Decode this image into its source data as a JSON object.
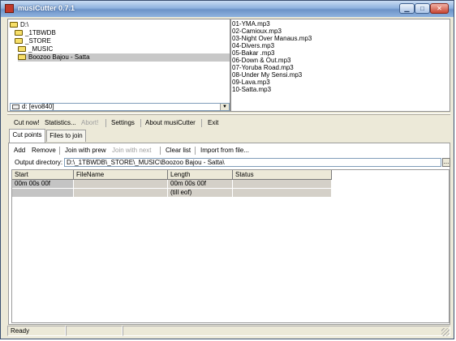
{
  "window": {
    "title": "musiCutter 0.7.1"
  },
  "tree": {
    "items": [
      {
        "label": "D:\\",
        "level": 0,
        "selected": false
      },
      {
        "label": "_1TBWDB",
        "level": 1,
        "selected": false
      },
      {
        "label": "_STORE",
        "level": 1,
        "selected": false
      },
      {
        "label": "_MUSIC",
        "level": 2,
        "selected": false
      },
      {
        "label": "Boozoo Bajou - Satta",
        "level": 2,
        "selected": true
      }
    ],
    "drive": "d: [evo840]"
  },
  "files": [
    "01-YMA.mp3",
    "02-Camioux.mp3",
    "03-Night Over Manaus.mp3",
    "04-Divers.mp3",
    "05-Bakar .mp3",
    "06-Down & Out.mp3",
    "07-Yoruba Road.mp3",
    "08-Under My Sensi.mp3",
    "09-Lava.mp3",
    "10-Satta.mp3"
  ],
  "toolbar": {
    "cut_now": "Cut now!",
    "statistics": "Statistics...",
    "abort": "Abort!",
    "settings": "Settings",
    "about": "About musiCutter",
    "exit": "Exit"
  },
  "tabs": {
    "cut_points": "Cut points",
    "files_to_join": "Files to join"
  },
  "cutpoints_toolbar": {
    "add": "Add",
    "remove": "Remove",
    "join_prev": "Join with prew",
    "join_next": "Join with next",
    "clear": "Clear list",
    "import": "Import from file..."
  },
  "output": {
    "label": "Output directory:",
    "value": "D:\\_1TBWDB\\_STORE\\_MUSIC\\Boozoo Bajou - Satta\\",
    "browse": "..."
  },
  "grid": {
    "headers": [
      "Start",
      "FileName",
      "Length",
      "Status"
    ],
    "rows": [
      [
        "00m 00s 00f",
        "",
        "00m 00s 00f",
        ""
      ],
      [
        "",
        "",
        "(till eof)",
        ""
      ]
    ]
  },
  "status": {
    "text": "Ready",
    "panel2": "",
    "panel3": ""
  }
}
